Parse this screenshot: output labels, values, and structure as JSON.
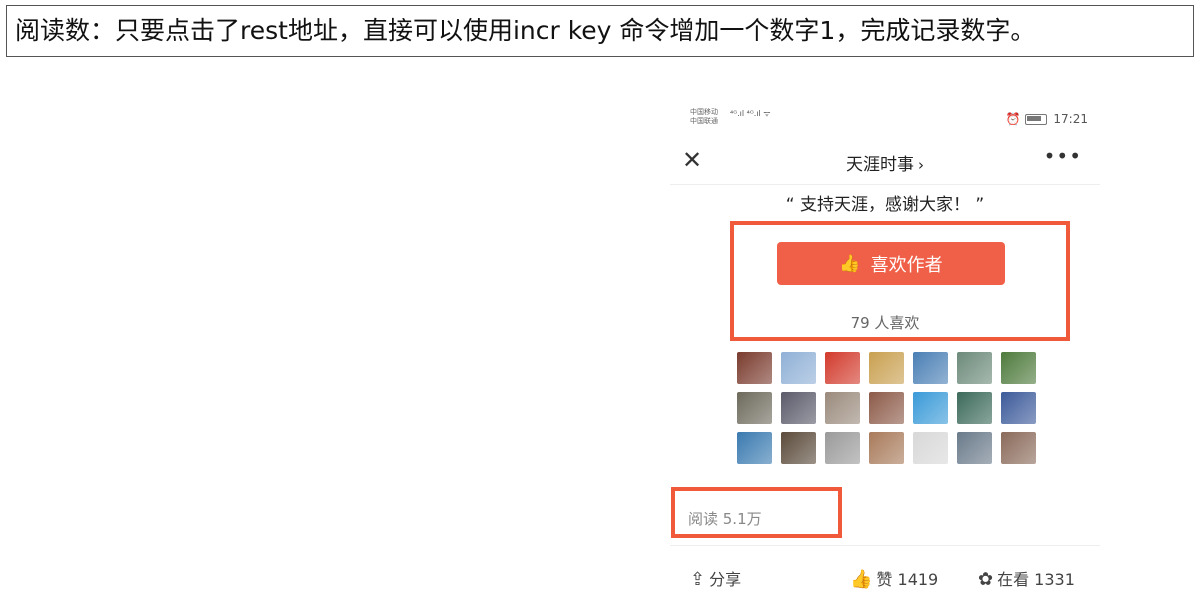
{
  "caption": "阅读数：只要点击了rest地址，直接可以使用incr key 命令增加一个数字1，完成记录数字。",
  "status": {
    "carrier1": "中国移动",
    "carrier2": "中国联通",
    "signal": "⁴ᴳ.ıl ⁴ᴳ.ıl ᯤ",
    "alarm": "⏰",
    "time": "17:21"
  },
  "nav": {
    "title": "天涯时事",
    "chevron": "›",
    "close": "✕",
    "more": "•••"
  },
  "quote": "“ 支持天涯，感谢大家！ ”",
  "like_button": {
    "icon": "thumb-up-icon",
    "label": "喜欢作者"
  },
  "like_count": "79 人喜欢",
  "avatar_colors": [
    "#7a3b2e",
    "#8fb0d6",
    "#d23a2c",
    "#c9a050",
    "#4a7fb5",
    "#6c8a7a",
    "#4e7a3c",
    "#6d6a5c",
    "#5a5a6a",
    "#9a8a7c",
    "#8c5a48",
    "#3a9ad8",
    "#3c6a5a",
    "#3c5a9a",
    "#3a7ab0",
    "#5a4a3a",
    "#9a9a9a",
    "#a87a5a",
    "#d8d8d8",
    "#6a7a8a",
    "#8a6a5a"
  ],
  "read_count": "阅读 5.1万",
  "actions": {
    "share": {
      "icon": "share-icon",
      "label": "分享"
    },
    "zan": {
      "icon": "thumb-up-icon",
      "label": "赞 1419"
    },
    "kan": {
      "icon": "flower-icon",
      "label": "在看 1331"
    }
  }
}
